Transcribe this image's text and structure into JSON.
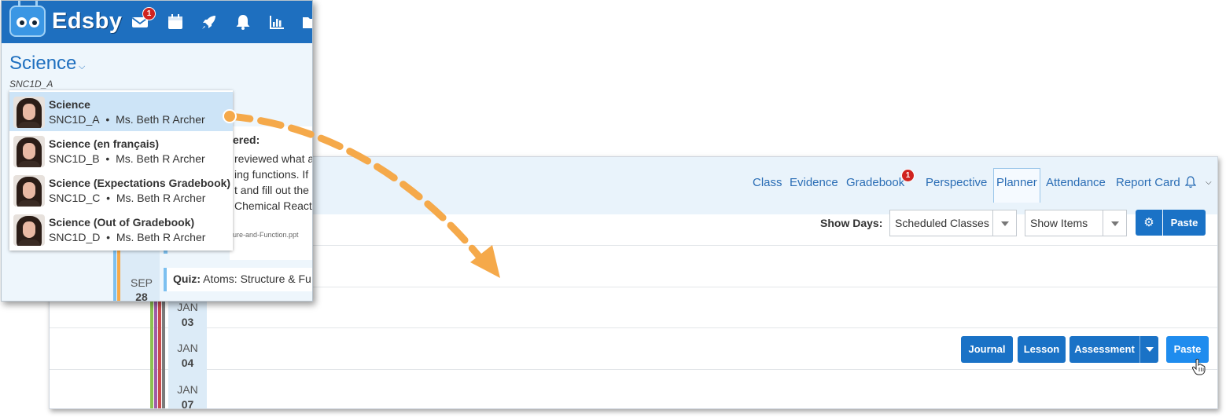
{
  "app": {
    "logo_text": "Edsby",
    "mail_badge": "1"
  },
  "course": {
    "title": "Science",
    "code": "SNC1D_A",
    "menu": [
      {
        "name": "Science",
        "code": "SNC1D_A",
        "teacher": "Ms. Beth R Archer"
      },
      {
        "name": "Science (en français)",
        "code": "SNC1D_B",
        "teacher": "Ms. Beth R Archer"
      },
      {
        "name": "Science (Expectations Gradebook)",
        "code": "SNC1D_C",
        "teacher": "Ms. Beth R Archer"
      },
      {
        "name": "Science (Out of Gradebook)",
        "code": "SNC1D_D",
        "teacher": "Ms. Beth R Archer"
      }
    ],
    "separator": "•"
  },
  "background": {
    "line1": "ered:",
    "line2": "reviewed what a",
    "line3": "ing functions. If",
    "line4": "t and fill out the",
    "line5": "Chemical Reacti",
    "file": "cture-and-Function.ppt",
    "sep_month": "SEP",
    "sep_day": "28",
    "quiz_label": "Quiz:",
    "quiz_title": " Atoms: Structure & Fu"
  },
  "planner": {
    "nav": [
      "Class",
      "Evidence",
      "Gradebook",
      "Perspective",
      "Planner",
      "Attendance",
      "Report Card"
    ],
    "gradebook_badge": "1",
    "show_days_label": "Show Days:",
    "show_days_value": "Scheduled Classes",
    "show_items_value": "Show Items",
    "paste_top": "Paste",
    "dates": [
      {
        "month": "JAN",
        "day": "03"
      },
      {
        "month": "JAN",
        "day": "04"
      },
      {
        "month": "JAN",
        "day": "07"
      }
    ],
    "buttons": {
      "journal": "Journal",
      "lesson": "Lesson",
      "assessment": "Assessment",
      "paste": "Paste"
    }
  },
  "colors": {
    "brand_blue": "#1e6fbf",
    "button_blue": "#1a72c6",
    "arrow_orange": "#f5a94a",
    "badge_red": "#d0231f",
    "stripe_colors": [
      "#8cc152",
      "#a05ca8",
      "#c94c4c",
      "#7b7b7b"
    ]
  }
}
